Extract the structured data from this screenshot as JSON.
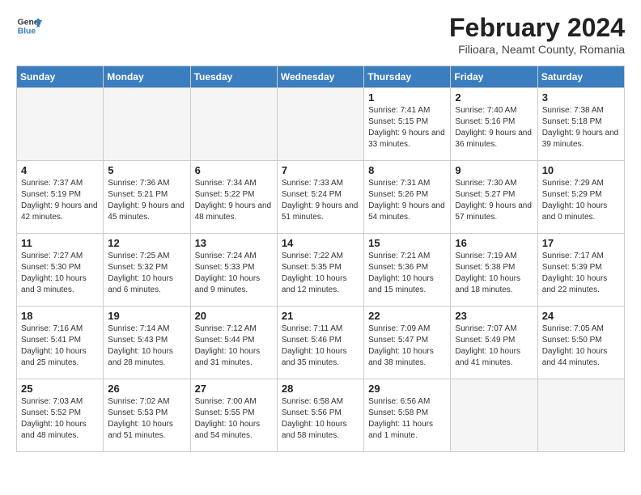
{
  "header": {
    "logo_general": "General",
    "logo_blue": "Blue",
    "month_year": "February 2024",
    "location": "Filioara, Neamt County, Romania"
  },
  "weekdays": [
    "Sunday",
    "Monday",
    "Tuesday",
    "Wednesday",
    "Thursday",
    "Friday",
    "Saturday"
  ],
  "weeks": [
    [
      {
        "day": "",
        "empty": true
      },
      {
        "day": "",
        "empty": true
      },
      {
        "day": "",
        "empty": true
      },
      {
        "day": "",
        "empty": true
      },
      {
        "day": "1",
        "sunrise": "7:41 AM",
        "sunset": "5:15 PM",
        "daylight": "9 hours and 33 minutes."
      },
      {
        "day": "2",
        "sunrise": "7:40 AM",
        "sunset": "5:16 PM",
        "daylight": "9 hours and 36 minutes."
      },
      {
        "day": "3",
        "sunrise": "7:38 AM",
        "sunset": "5:18 PM",
        "daylight": "9 hours and 39 minutes."
      }
    ],
    [
      {
        "day": "4",
        "sunrise": "7:37 AM",
        "sunset": "5:19 PM",
        "daylight": "9 hours and 42 minutes."
      },
      {
        "day": "5",
        "sunrise": "7:36 AM",
        "sunset": "5:21 PM",
        "daylight": "9 hours and 45 minutes."
      },
      {
        "day": "6",
        "sunrise": "7:34 AM",
        "sunset": "5:22 PM",
        "daylight": "9 hours and 48 minutes."
      },
      {
        "day": "7",
        "sunrise": "7:33 AM",
        "sunset": "5:24 PM",
        "daylight": "9 hours and 51 minutes."
      },
      {
        "day": "8",
        "sunrise": "7:31 AM",
        "sunset": "5:26 PM",
        "daylight": "9 hours and 54 minutes."
      },
      {
        "day": "9",
        "sunrise": "7:30 AM",
        "sunset": "5:27 PM",
        "daylight": "9 hours and 57 minutes."
      },
      {
        "day": "10",
        "sunrise": "7:29 AM",
        "sunset": "5:29 PM",
        "daylight": "10 hours and 0 minutes."
      }
    ],
    [
      {
        "day": "11",
        "sunrise": "7:27 AM",
        "sunset": "5:30 PM",
        "daylight": "10 hours and 3 minutes."
      },
      {
        "day": "12",
        "sunrise": "7:25 AM",
        "sunset": "5:32 PM",
        "daylight": "10 hours and 6 minutes."
      },
      {
        "day": "13",
        "sunrise": "7:24 AM",
        "sunset": "5:33 PM",
        "daylight": "10 hours and 9 minutes."
      },
      {
        "day": "14",
        "sunrise": "7:22 AM",
        "sunset": "5:35 PM",
        "daylight": "10 hours and 12 minutes."
      },
      {
        "day": "15",
        "sunrise": "7:21 AM",
        "sunset": "5:36 PM",
        "daylight": "10 hours and 15 minutes."
      },
      {
        "day": "16",
        "sunrise": "7:19 AM",
        "sunset": "5:38 PM",
        "daylight": "10 hours and 18 minutes."
      },
      {
        "day": "17",
        "sunrise": "7:17 AM",
        "sunset": "5:39 PM",
        "daylight": "10 hours and 22 minutes."
      }
    ],
    [
      {
        "day": "18",
        "sunrise": "7:16 AM",
        "sunset": "5:41 PM",
        "daylight": "10 hours and 25 minutes."
      },
      {
        "day": "19",
        "sunrise": "7:14 AM",
        "sunset": "5:43 PM",
        "daylight": "10 hours and 28 minutes."
      },
      {
        "day": "20",
        "sunrise": "7:12 AM",
        "sunset": "5:44 PM",
        "daylight": "10 hours and 31 minutes."
      },
      {
        "day": "21",
        "sunrise": "7:11 AM",
        "sunset": "5:46 PM",
        "daylight": "10 hours and 35 minutes."
      },
      {
        "day": "22",
        "sunrise": "7:09 AM",
        "sunset": "5:47 PM",
        "daylight": "10 hours and 38 minutes."
      },
      {
        "day": "23",
        "sunrise": "7:07 AM",
        "sunset": "5:49 PM",
        "daylight": "10 hours and 41 minutes."
      },
      {
        "day": "24",
        "sunrise": "7:05 AM",
        "sunset": "5:50 PM",
        "daylight": "10 hours and 44 minutes."
      }
    ],
    [
      {
        "day": "25",
        "sunrise": "7:03 AM",
        "sunset": "5:52 PM",
        "daylight": "10 hours and 48 minutes."
      },
      {
        "day": "26",
        "sunrise": "7:02 AM",
        "sunset": "5:53 PM",
        "daylight": "10 hours and 51 minutes."
      },
      {
        "day": "27",
        "sunrise": "7:00 AM",
        "sunset": "5:55 PM",
        "daylight": "10 hours and 54 minutes."
      },
      {
        "day": "28",
        "sunrise": "6:58 AM",
        "sunset": "5:56 PM",
        "daylight": "10 hours and 58 minutes."
      },
      {
        "day": "29",
        "sunrise": "6:56 AM",
        "sunset": "5:58 PM",
        "daylight": "11 hours and 1 minute."
      },
      {
        "day": "",
        "empty": true
      },
      {
        "day": "",
        "empty": true
      }
    ]
  ]
}
